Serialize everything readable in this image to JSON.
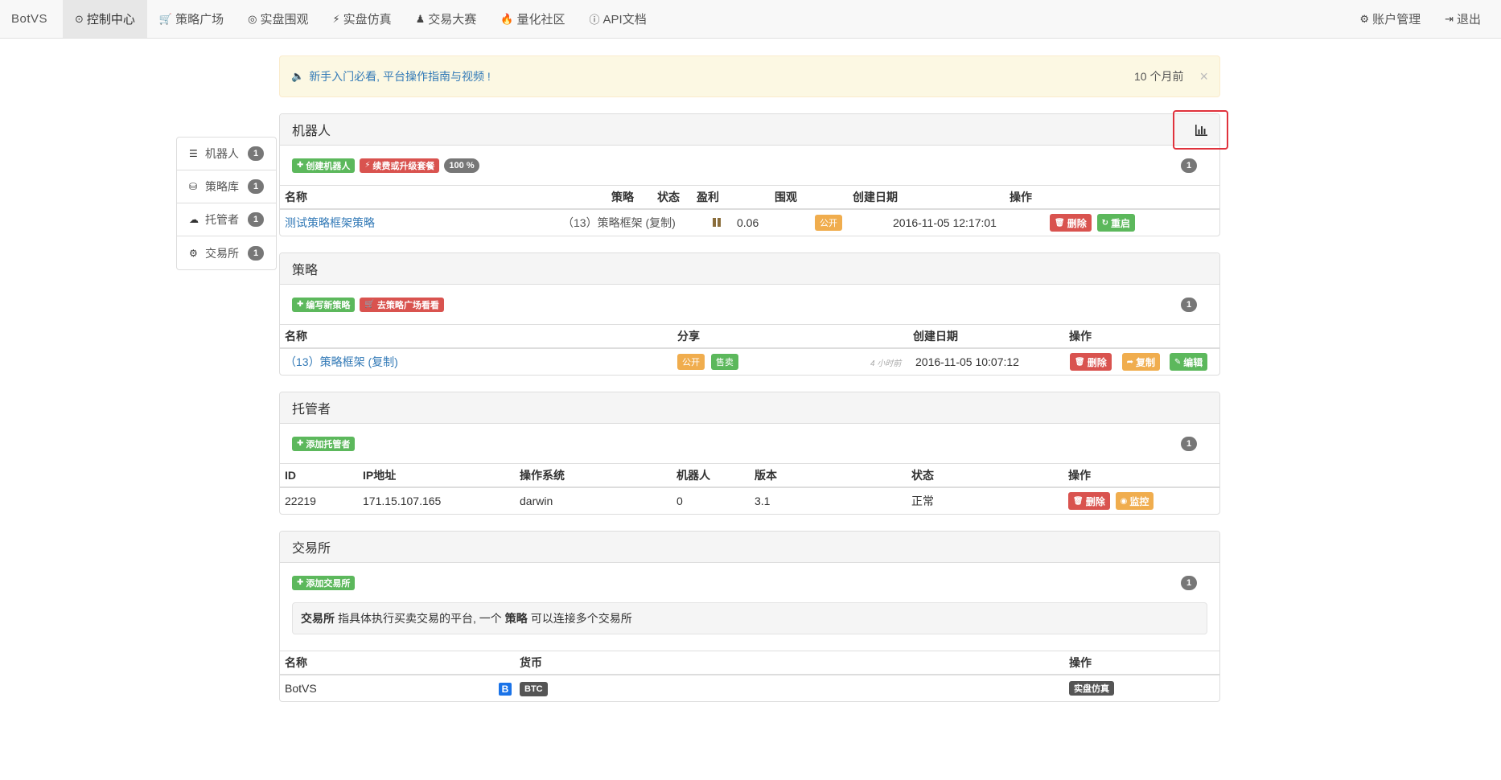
{
  "nav": {
    "brand": "BotVS",
    "items": [
      {
        "icon": "⊙",
        "label": "控制中心",
        "active": true
      },
      {
        "icon": "🛒",
        "label": "策略广场"
      },
      {
        "icon": "◎",
        "label": "实盘围观"
      },
      {
        "icon": "⚡",
        "label": "实盘仿真"
      },
      {
        "icon": "♟",
        "label": "交易大赛"
      },
      {
        "icon": "🔥",
        "label": "量化社区"
      },
      {
        "icon": "ⓘ",
        "label": "API文档"
      }
    ],
    "right": [
      {
        "icon": "⚙",
        "label": "账户管理"
      },
      {
        "icon": "⇥",
        "label": "退出"
      }
    ]
  },
  "sidebar": {
    "items": [
      {
        "icon": "☰",
        "label": "机器人",
        "count": "1"
      },
      {
        "icon": "⛁",
        "label": "策略库",
        "count": "1"
      },
      {
        "icon": "☁",
        "label": "托管者",
        "count": "1"
      },
      {
        "icon": "⚙",
        "label": "交易所",
        "count": "1"
      }
    ]
  },
  "alert": {
    "text": "新手入门必看, 平台操作指南与视频 !",
    "time": "10 个月前",
    "close": "×"
  },
  "robots": {
    "title": "机器人",
    "buttons": {
      "create": "创建机器人",
      "renew": "续费或升级套餐",
      "percent": "100 %"
    },
    "count": "1",
    "headers": {
      "name": "名称",
      "strategy": "策略",
      "status": "状态",
      "profit": "盈利",
      "watch": "围观",
      "created": "创建日期",
      "ops": "操作"
    },
    "rows": [
      {
        "name": "测试策略框架策略",
        "strategy": "（13）策略框架 (复制)",
        "profit": "0.06",
        "watch": "公开",
        "created": "2016-11-05 12:17:01",
        "delete": "删除",
        "restart": "重启"
      }
    ]
  },
  "strategies": {
    "title": "策略",
    "buttons": {
      "write": "编写新策略",
      "square": "去策略广场看看"
    },
    "count": "1",
    "headers": {
      "name": "名称",
      "share": "分享",
      "created": "创建日期",
      "ops": "操作"
    },
    "rows": [
      {
        "name": "（13）策略框架 (复制)",
        "public": "公开",
        "sell": "售卖",
        "ago": "4 小时前",
        "created": "2016-11-05 10:07:12",
        "delete": "删除",
        "copy": "复制",
        "edit": "编辑"
      }
    ]
  },
  "hosts": {
    "title": "托管者",
    "buttons": {
      "add": "添加托管者"
    },
    "count": "1",
    "headers": {
      "id": "ID",
      "ip": "IP地址",
      "os": "操作系统",
      "robots": "机器人",
      "version": "版本",
      "status": "状态",
      "ops": "操作"
    },
    "rows": [
      {
        "id": "22219",
        "ip": "171.15.107.165",
        "os": "darwin",
        "robots": "0",
        "version": "3.1",
        "status": "正常",
        "delete": "删除",
        "monitor": "监控"
      }
    ]
  },
  "exchanges": {
    "title": "交易所",
    "buttons": {
      "add": "添加交易所"
    },
    "count": "1",
    "info": {
      "term": "交易所",
      "middle": "指具体执行买卖交易的平台, 一个",
      "strategy": "策略",
      "tail": "可以连接多个交易所"
    },
    "headers": {
      "name": "名称",
      "currency": "货币",
      "ops": "操作"
    },
    "rows": [
      {
        "name": "BotVS",
        "logo": "B",
        "currency": "BTC",
        "action": "实盘仿真"
      }
    ]
  },
  "colors": {
    "green": "#5cb85c",
    "red": "#d9534f",
    "orange": "#f0ad4e",
    "gray": "#777777",
    "link": "#337ab7",
    "highlight": "#e0323c"
  }
}
